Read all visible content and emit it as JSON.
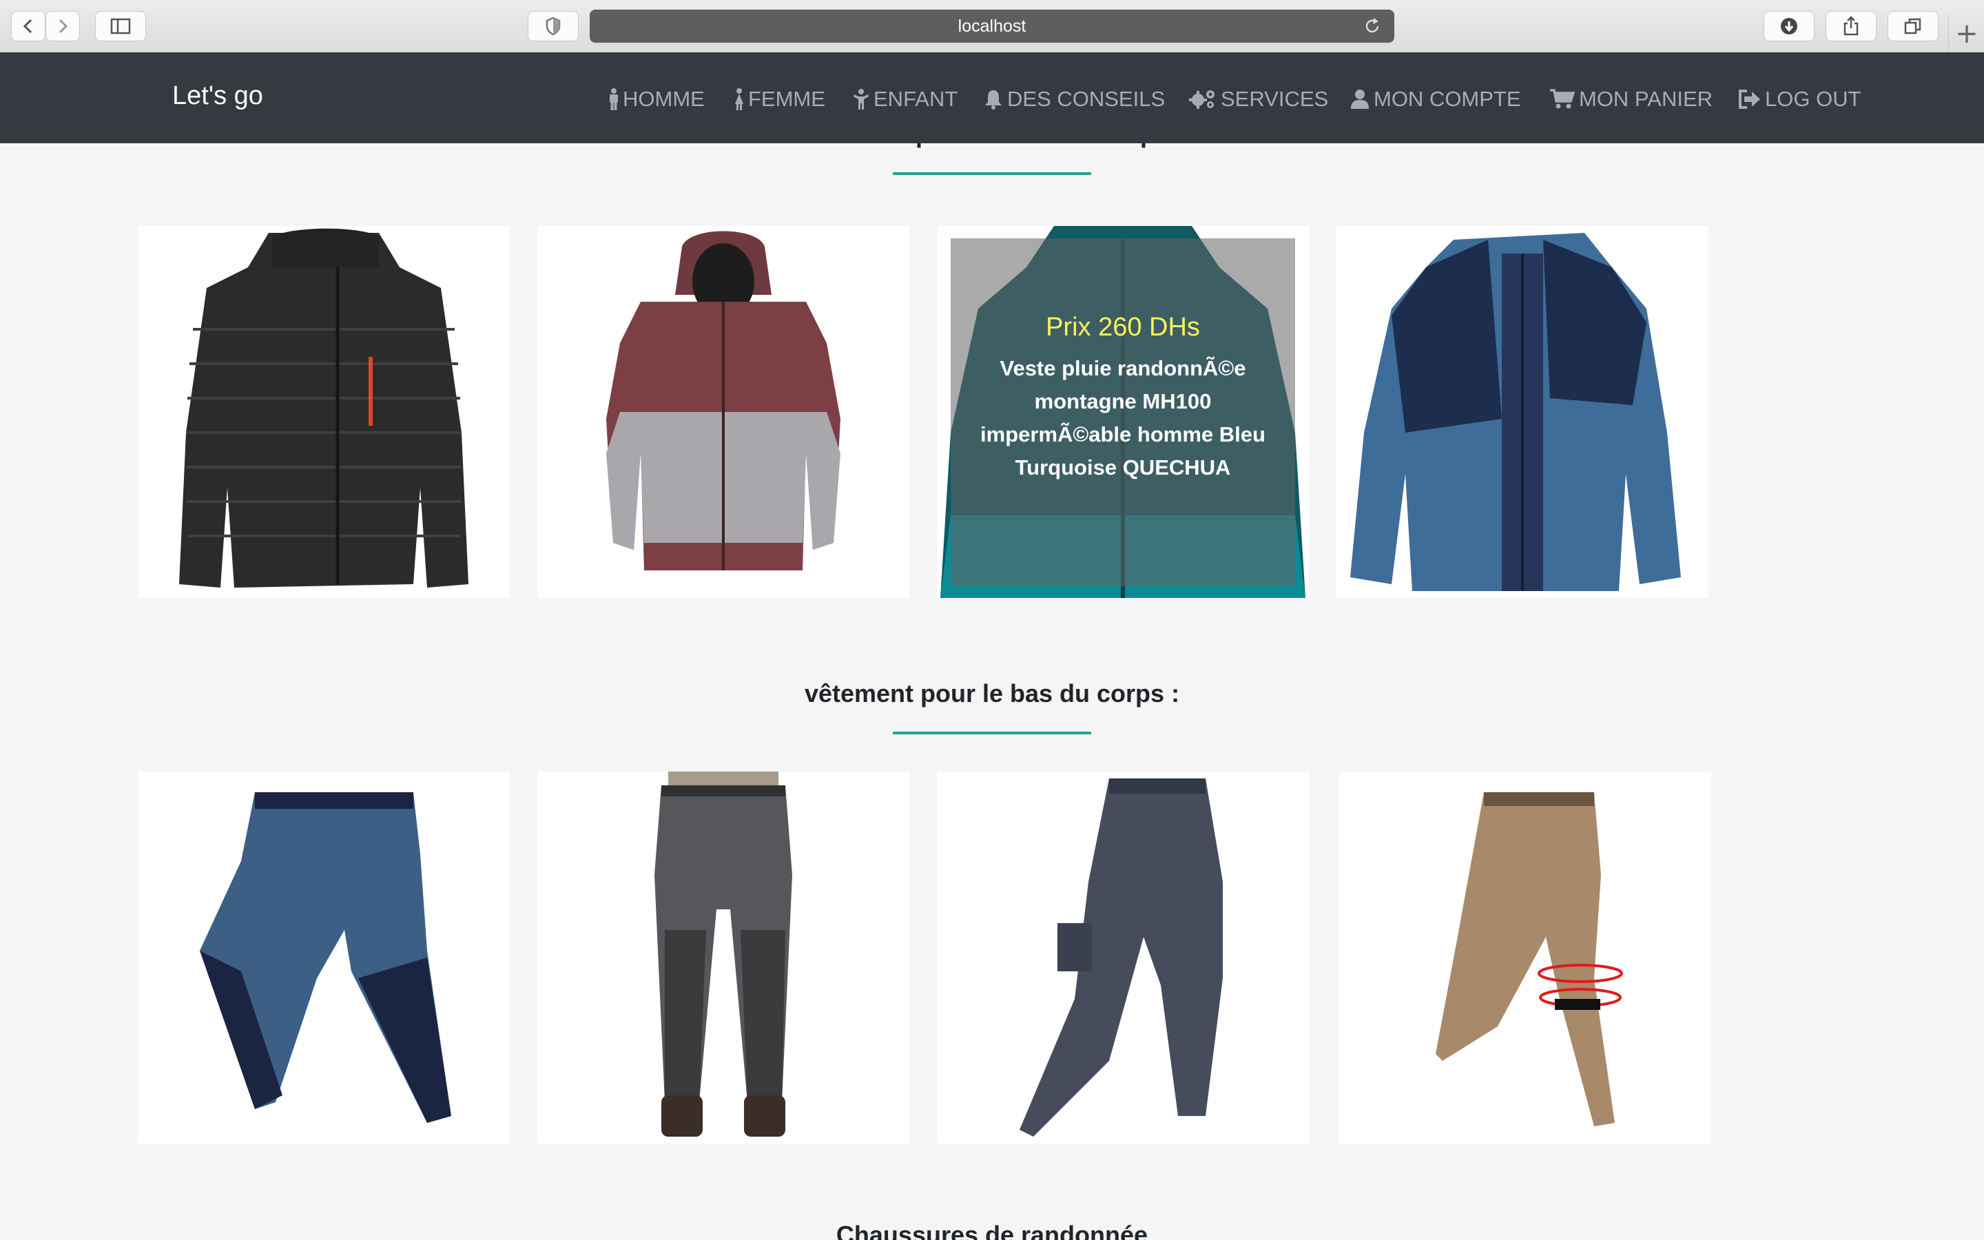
{
  "browser": {
    "url": "localhost",
    "new_tab_label": "+"
  },
  "navbar": {
    "brand": "Let's go",
    "items": [
      {
        "label": "HOMME",
        "icon": "male-icon"
      },
      {
        "label": "FEMME",
        "icon": "female-icon"
      },
      {
        "label": "ENFANT",
        "icon": "child-icon"
      },
      {
        "label": "DES CONSEILS",
        "icon": "bell-icon"
      },
      {
        "label": "SERVICES",
        "icon": "gears-icon"
      },
      {
        "label": "MON COMPTE",
        "icon": "user-icon"
      },
      {
        "label": "MON PANIER",
        "icon": "cart-icon"
      },
      {
        "label": "LOG OUT",
        "icon": "sign-out-icon"
      }
    ]
  },
  "sections": [
    {
      "title": "vêtement pour le haut du corps :",
      "products": [
        {
          "image": "black puffer jacket",
          "color": "#2b2b2b"
        },
        {
          "image": "burgundy and grey hooded jacket",
          "color": "#7b3f44"
        },
        {
          "image": "turquoise rain jacket",
          "color": "#0f5a63",
          "overlay": {
            "price": "Prix 260 DHs",
            "name": "Veste pluie randonnÃ©e montagne MH100 impermÃ©able homme Bleu Turquoise QUECHUA"
          }
        },
        {
          "image": "blue 3-in-1 jacket",
          "color": "#3f6d9a"
        }
      ]
    },
    {
      "title": "vêtement pour le bas du corps :",
      "products": [
        {
          "image": "blue hiking trousers",
          "color": "#3d5f86"
        },
        {
          "image": "grey hiking trousers",
          "color": "#55575a"
        },
        {
          "image": "navy cargo trousers",
          "color": "#464c5c"
        },
        {
          "image": "beige zip-off trousers",
          "color": "#a88a6a"
        }
      ]
    },
    {
      "title": "Chaussures de randonnée"
    }
  ]
}
